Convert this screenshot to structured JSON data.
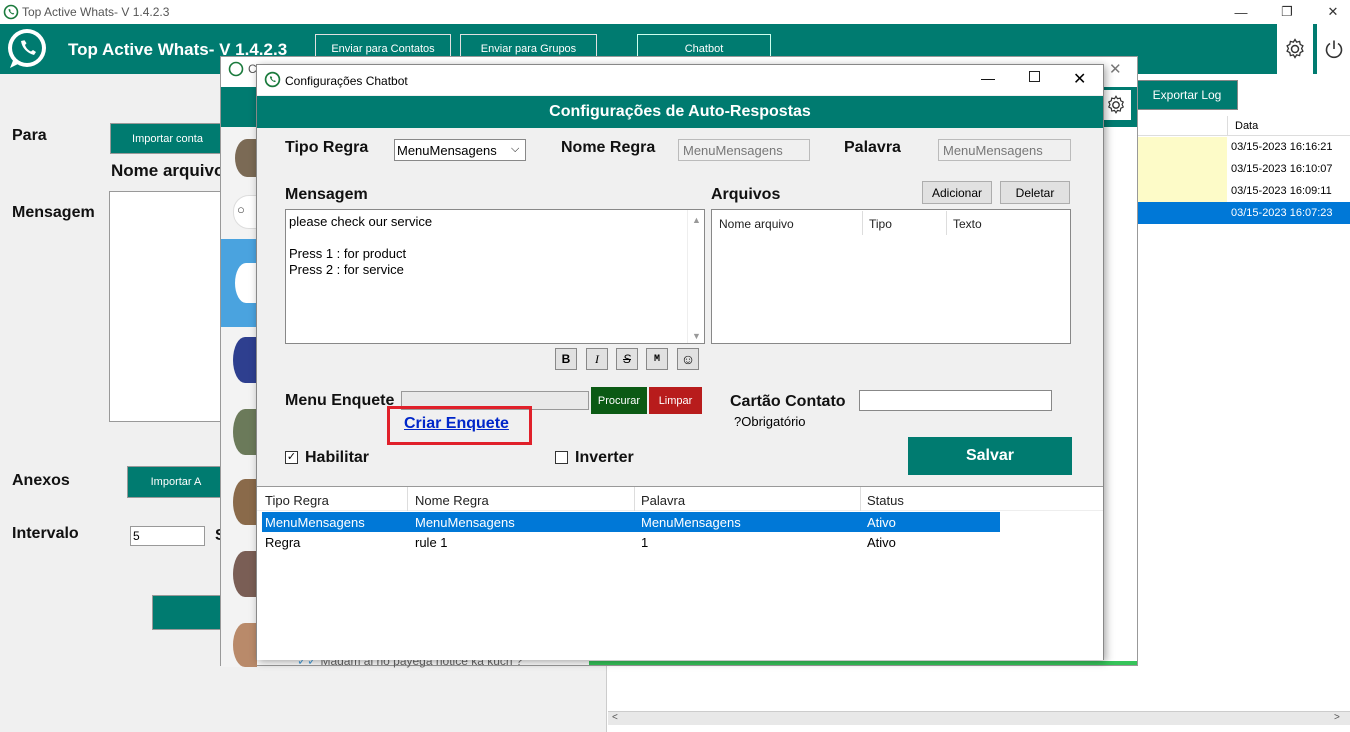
{
  "app": {
    "title": "Top Active Whats- V 1.4.2.3",
    "header_title": "Top Active Whats- V 1.4.2.3",
    "nav": [
      "Enviar para Contatos",
      "Enviar para Grupos",
      "Chatbot"
    ],
    "window_controls": {
      "restore": "❐",
      "close": "✕"
    }
  },
  "main": {
    "para_label": "Para",
    "import_contacts_label": "Importar conta",
    "nome_arquivo_label": "Nome arquivo",
    "mensagem_label": "Mensagem",
    "anexos_label": "Anexos",
    "import_attach_label": "Importar A",
    "intervalo_label": "Intervalo",
    "intervalo_value": "5",
    "s_label": "S"
  },
  "log": {
    "export_label": "Exportar Log",
    "date_header": "Data",
    "dates": [
      "03/15-2023 16:16:21",
      "03/15-2023 16:10:07",
      "03/15-2023 16:09:11",
      "03/15-2023 16:07:23"
    ]
  },
  "chat_window": {
    "title_letter": "C",
    "last_message": "Madam ai ho payega notice ka kuch ?"
  },
  "dialog": {
    "title": "Configurações Chatbot",
    "banner": "Configurações de Auto-Respostas",
    "tipo_regra_label": "Tipo Regra",
    "tipo_regra_value": "MenuMensagens",
    "nome_regra_label": "Nome Regra",
    "nome_regra_value": "MenuMensagens",
    "palavra_label": "Palavra",
    "palavra_value": "MenuMensagens",
    "mensagem_label": "Mensagem",
    "message_lines": [
      "please check our service",
      "",
      "Press 1 : for product",
      "Press 2 : for service"
    ],
    "arquivos_label": "Arquivos",
    "adicionar_label": "Adicionar",
    "deletar_label": "Deletar",
    "files_columns": [
      "Nome arquivo",
      "Tipo",
      "Texto"
    ],
    "format_buttons": [
      "B",
      "I",
      "S",
      "M",
      "☺"
    ],
    "menu_enquete_label": "Menu Enquete",
    "procurar_label": "Procurar",
    "limpar_label": "Limpar",
    "criar_enquete_label": "Criar Enquete",
    "cartao_contato_label": "Cartão Contato",
    "obrigatorio_label": "?Obrigatório",
    "habilitar_label": "Habilitar",
    "inverter_label": "Inverter",
    "salvar_label": "Salvar",
    "rules_columns": [
      "Tipo Regra",
      "Nome Regra",
      "Palavra",
      "Status"
    ],
    "rules": [
      {
        "tipo": "MenuMensagens",
        "nome": "MenuMensagens",
        "palavra": "MenuMensagens",
        "status": "Ativo"
      },
      {
        "tipo": "Regra",
        "nome": "rule 1",
        "palavra": "1",
        "status": "Ativo"
      }
    ]
  },
  "colors": {
    "brand": "#007b70",
    "selection": "#0078d7",
    "highlight_box": "#e0202a",
    "procurar": "#0b5a14",
    "limpar": "#b81c1c"
  }
}
